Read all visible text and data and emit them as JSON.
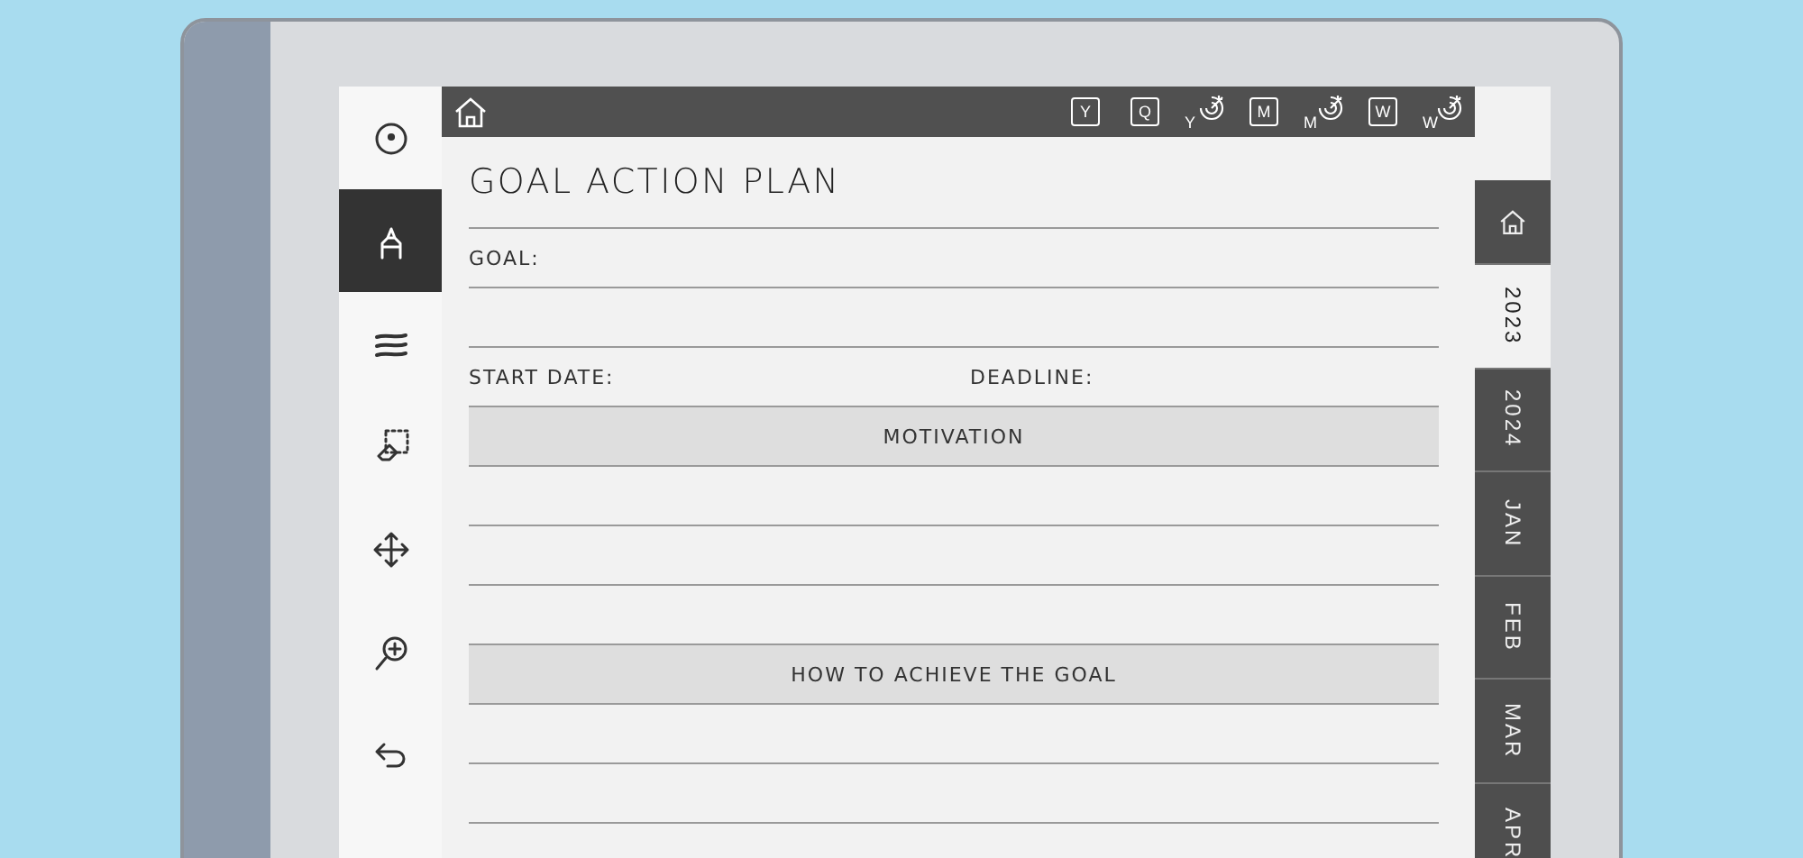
{
  "top_bar": {
    "items": [
      {
        "kind": "calendar",
        "label": "Y"
      },
      {
        "kind": "calendar",
        "label": "Q"
      },
      {
        "kind": "goal",
        "label": "Y"
      },
      {
        "kind": "calendar",
        "label": "M"
      },
      {
        "kind": "goal",
        "label": "M"
      },
      {
        "kind": "calendar",
        "label": "W"
      },
      {
        "kind": "goal",
        "label": "W"
      }
    ]
  },
  "tools": [
    {
      "kind": "circle",
      "selected": false
    },
    {
      "kind": "pen",
      "selected": true
    },
    {
      "kind": "lines",
      "selected": false
    },
    {
      "kind": "eraser",
      "selected": false
    },
    {
      "kind": "move",
      "selected": false
    },
    {
      "kind": "zoom",
      "selected": false
    },
    {
      "kind": "undo",
      "selected": false
    }
  ],
  "side_tabs": [
    {
      "kind": "home",
      "selected": false
    },
    {
      "kind": "text",
      "label": "2023",
      "selected": true
    },
    {
      "kind": "text",
      "label": "2024",
      "selected": false
    },
    {
      "kind": "text",
      "label": "JAN",
      "selected": false
    },
    {
      "kind": "text",
      "label": "FEB",
      "selected": false
    },
    {
      "kind": "text",
      "label": "MAR",
      "selected": false
    },
    {
      "kind": "text",
      "label": "APR",
      "selected": false
    }
  ],
  "page": {
    "title": "GOAL ACTION PLAN",
    "goal_label": "GOAL:",
    "start_label": "START DATE:",
    "deadline_label": "DEADLINE:",
    "sections": [
      {
        "heading": "MOTIVATION"
      },
      {
        "heading": "HOW TO ACHIEVE THE GOAL"
      }
    ]
  }
}
